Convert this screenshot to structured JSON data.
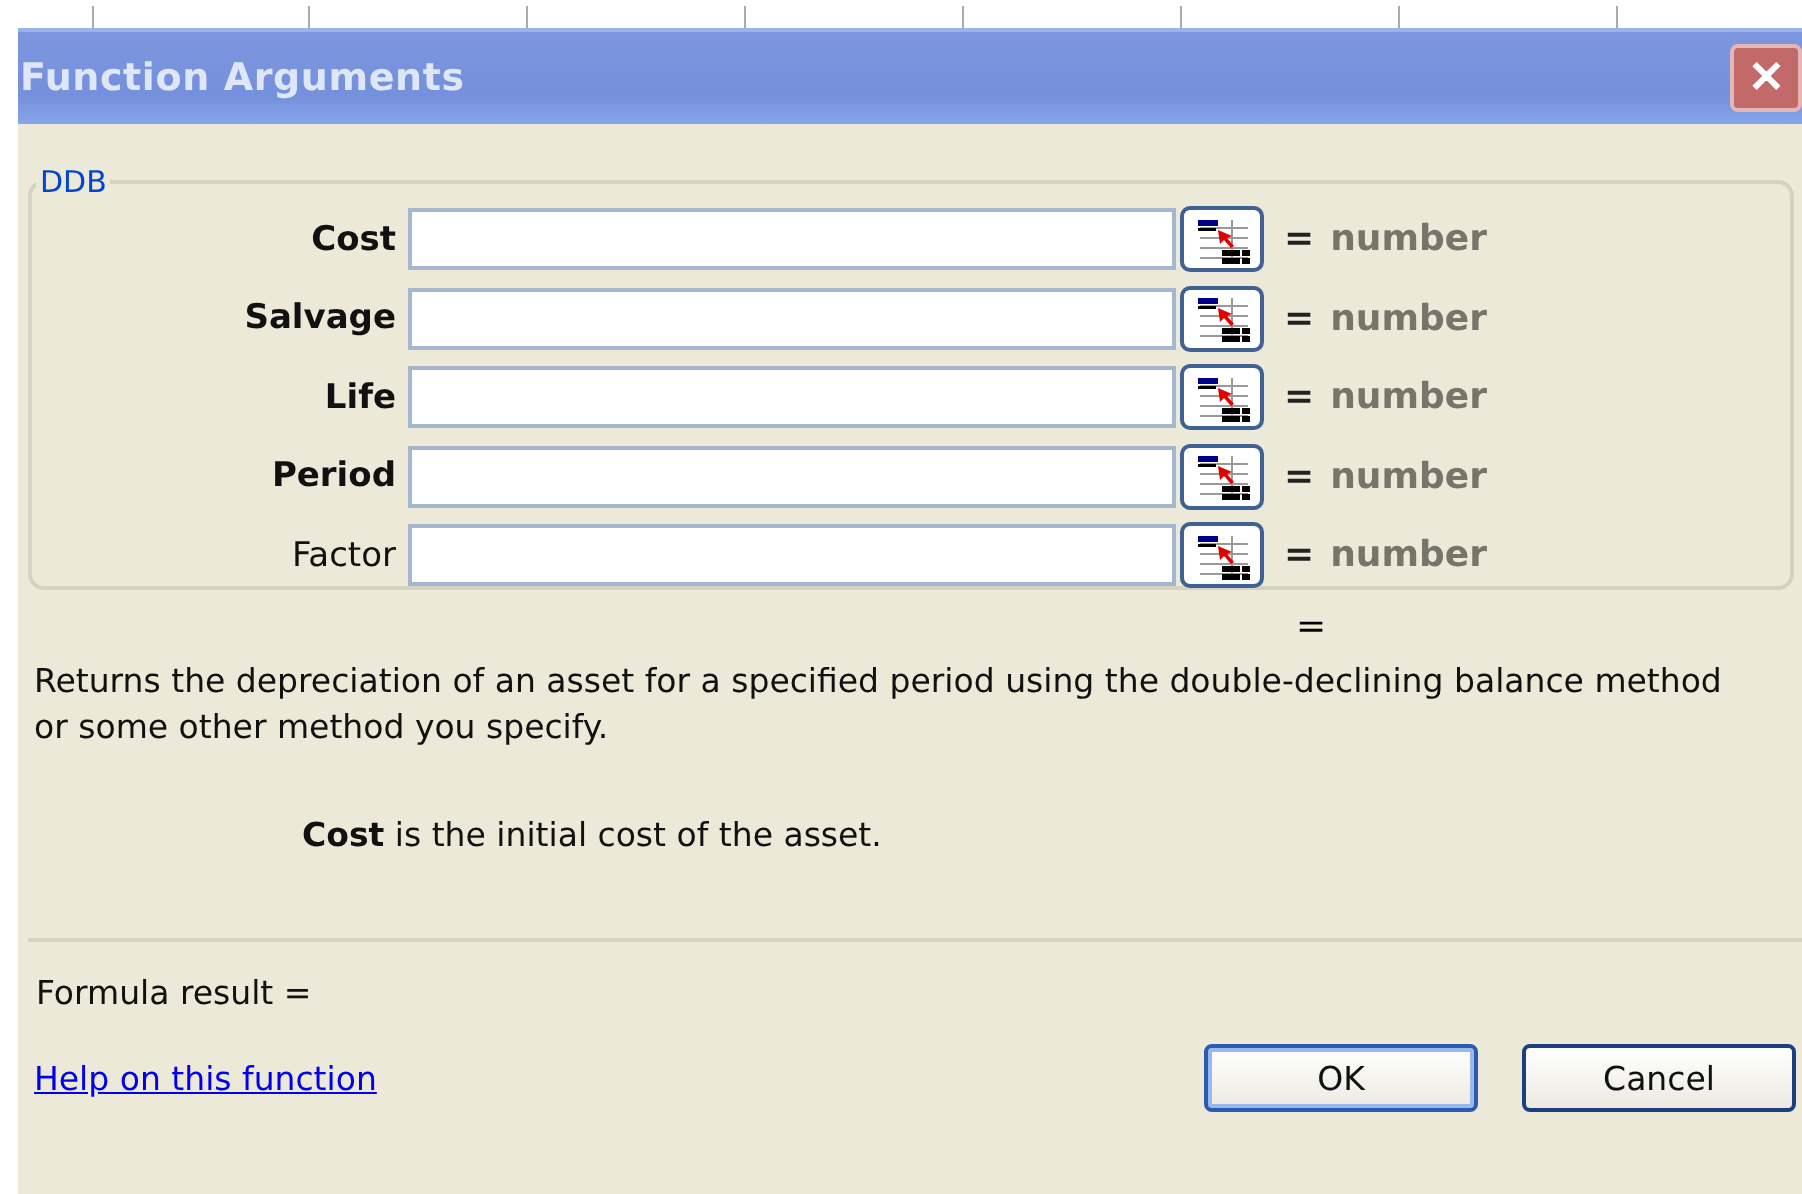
{
  "window": {
    "title": "Function Arguments",
    "close": "✕"
  },
  "group": {
    "title": "DDB",
    "arguments": [
      {
        "label": "Cost",
        "required": true,
        "equals": "=",
        "hint": "number"
      },
      {
        "label": "Salvage",
        "required": true,
        "equals": "=",
        "hint": "number"
      },
      {
        "label": "Life",
        "required": true,
        "equals": "=",
        "hint": "number"
      },
      {
        "label": "Period",
        "required": true,
        "equals": "=",
        "hint": "number"
      },
      {
        "label": "Factor",
        "required": false,
        "equals": "=",
        "hint": "number"
      }
    ]
  },
  "result_equals": "=",
  "description": "Returns the depreciation of an asset for a specified period using the double-declining balance method or some other method you specify.",
  "argument_help": "**Cost** is the initial cost of the asset.",
  "formula_result": "Formula result =",
  "help_link": "Help on this function",
  "buttons": [
    {
      "label": "OK",
      "default": true
    },
    {
      "label": "Cancel",
      "default": false
    }
  ]
}
